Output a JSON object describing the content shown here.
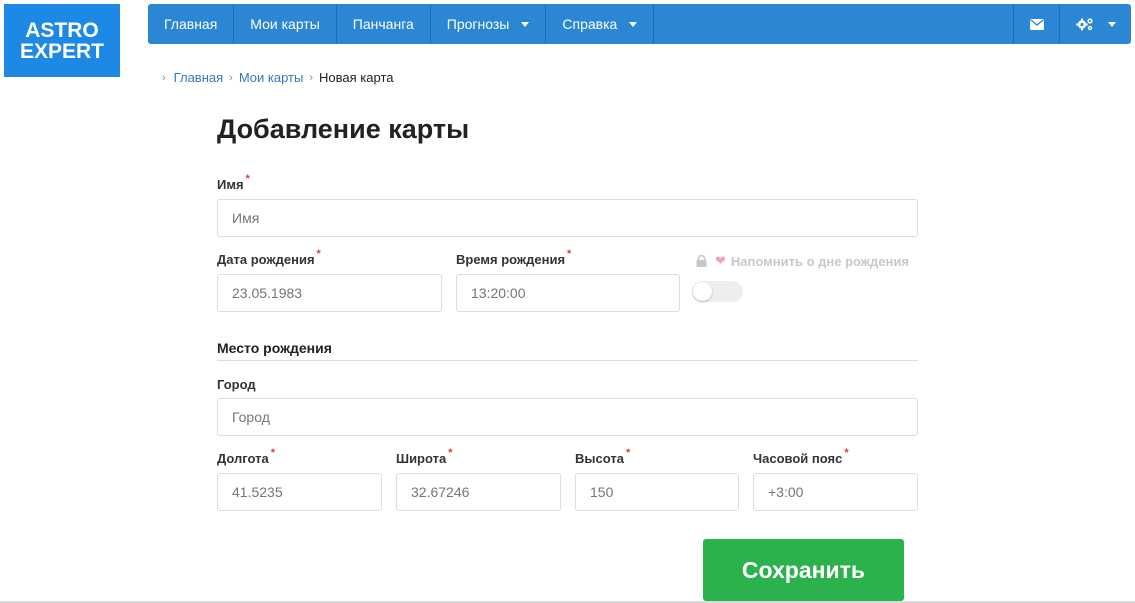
{
  "logo": {
    "line1": "ASTRO",
    "line2": "EXPERT",
    "color": "#1e88e5"
  },
  "nav": {
    "items": [
      {
        "label": "Главная",
        "dropdown": false
      },
      {
        "label": "Мои карты",
        "dropdown": false
      },
      {
        "label": "Панчанга",
        "dropdown": false
      },
      {
        "label": "Прогнозы",
        "dropdown": true
      },
      {
        "label": "Справка",
        "dropdown": true
      }
    ],
    "mail_icon": "envelope-icon",
    "settings_icon": "gears-icon",
    "color": "#2b87d3"
  },
  "breadcrumb": {
    "items": [
      "Главная",
      "Мои карты"
    ],
    "current": "Новая карта"
  },
  "page": {
    "title": "Добавление карты"
  },
  "form": {
    "name": {
      "label": "Имя",
      "placeholder": "Имя"
    },
    "birth_date": {
      "label": "Дата рождения",
      "placeholder": "23.05.1983"
    },
    "birth_time": {
      "label": "Время рождения",
      "placeholder": "13:20:00"
    },
    "reminder": {
      "label": "Напомнить о дне рождения",
      "enabled": false
    },
    "place_section": "Место рождения",
    "city": {
      "label": "Город",
      "placeholder": "Город"
    },
    "longitude": {
      "label": "Долгота",
      "placeholder": "41.5235"
    },
    "latitude": {
      "label": "Широта",
      "placeholder": "32.67246"
    },
    "altitude": {
      "label": "Высота",
      "placeholder": "150"
    },
    "timezone": {
      "label": "Часовой пояс",
      "placeholder": "+3:00"
    },
    "required_mark": "*",
    "save_label": "Сохранить",
    "save_color": "#2bb24c"
  }
}
